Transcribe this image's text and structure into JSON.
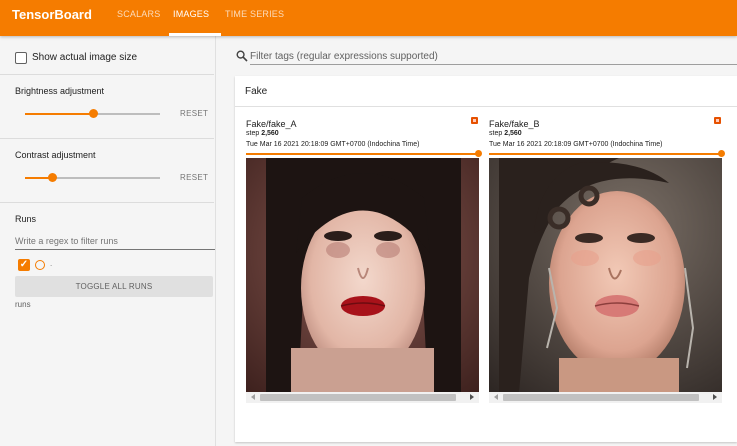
{
  "header": {
    "brand": "TensorBoard",
    "tabs": [
      {
        "label": "SCALARS",
        "active": false
      },
      {
        "label": "IMAGES",
        "active": true
      },
      {
        "label": "TIME SERIES",
        "active": false
      }
    ],
    "accent": "#f57c00"
  },
  "sidebar": {
    "show_actual_size_label": "Show actual image size",
    "show_actual_size_checked": false,
    "brightness": {
      "title": "Brightness adjustment",
      "reset_label": "RESET",
      "level": 0.5
    },
    "contrast": {
      "title": "Contrast adjustment",
      "reset_label": "RESET",
      "level": 0.2
    },
    "runs": {
      "title": "Runs",
      "filter_placeholder": "Write a regex to filter runs",
      "items": [
        {
          "name": ".",
          "checked": true
        }
      ],
      "toggle_all_label": "TOGGLE ALL RUNS",
      "footer": "runs"
    }
  },
  "main": {
    "tag_filter_placeholder": "Filter tags (regular expressions supported)",
    "group": {
      "title": "Fake",
      "cards": [
        {
          "tag": "Fake/fake_A",
          "step_prefix": "step",
          "step_value": "2,560",
          "timestamp": "Tue Mar 16 2021 20:18:09 GMT+0700 (Indochina Time)",
          "image_icon": "portrait-photo-icon"
        },
        {
          "tag": "Fake/fake_B",
          "step_prefix": "step",
          "step_value": "2,560",
          "timestamp": "Tue Mar 16 2021 20:18:09 GMT+0700 (Indochina Time)",
          "image_icon": "portrait-photo-icon"
        }
      ]
    }
  }
}
